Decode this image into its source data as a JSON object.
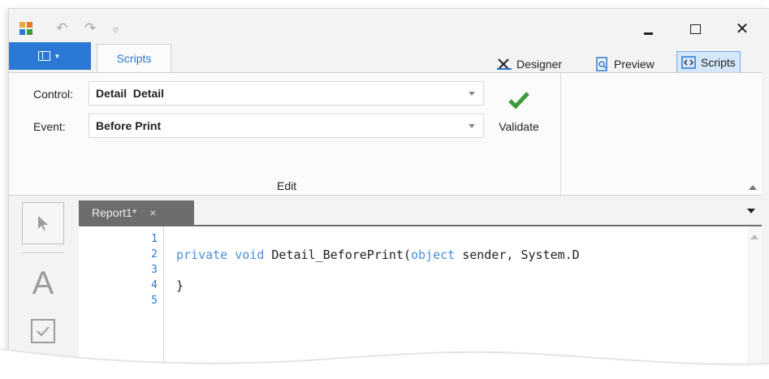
{
  "titlebar": {
    "undo_icon": "undo-arrow-icon",
    "redo_icon": "redo-arrow-icon",
    "customize_icon": "customize-quick-access-icon"
  },
  "ribbon": {
    "file_button_icon": "file-menu-icon",
    "tabs": [
      {
        "label": "Scripts"
      }
    ],
    "views": [
      {
        "label": "Designer",
        "icon": "designer-icon",
        "active": false
      },
      {
        "label": "Preview",
        "icon": "preview-icon",
        "active": false
      },
      {
        "label": "Scripts",
        "icon": "scripts-icon",
        "active": true
      }
    ],
    "control_label": "Control:",
    "control_value": "Detail  Detail",
    "event_label": "Event:",
    "event_value": "Before Print",
    "validate_label": "Validate",
    "group_label": "Edit"
  },
  "toolbox": {
    "tools": [
      "pointer-tool",
      "label-tool",
      "checkbox-tool"
    ],
    "text_tool_glyph": "A"
  },
  "document": {
    "tab_title": "Report1*",
    "tab_close": "×"
  },
  "editor": {
    "lines": [
      {
        "n": "1",
        "text": ""
      },
      {
        "n": "2",
        "kw1": "private",
        "kw2": "void",
        "mid": " Detail_BeforePrint(",
        "kw3": "object",
        "rest": " sender, System.D"
      },
      {
        "n": "3",
        "text": ""
      },
      {
        "n": "4",
        "text": "}"
      },
      {
        "n": "5",
        "text": ""
      }
    ]
  },
  "colors": {
    "accent": "#2b79d4",
    "keyword": "#4a8fd6",
    "validate_check": "#3a9b3a",
    "doc_tab": "#6d6d6d"
  }
}
